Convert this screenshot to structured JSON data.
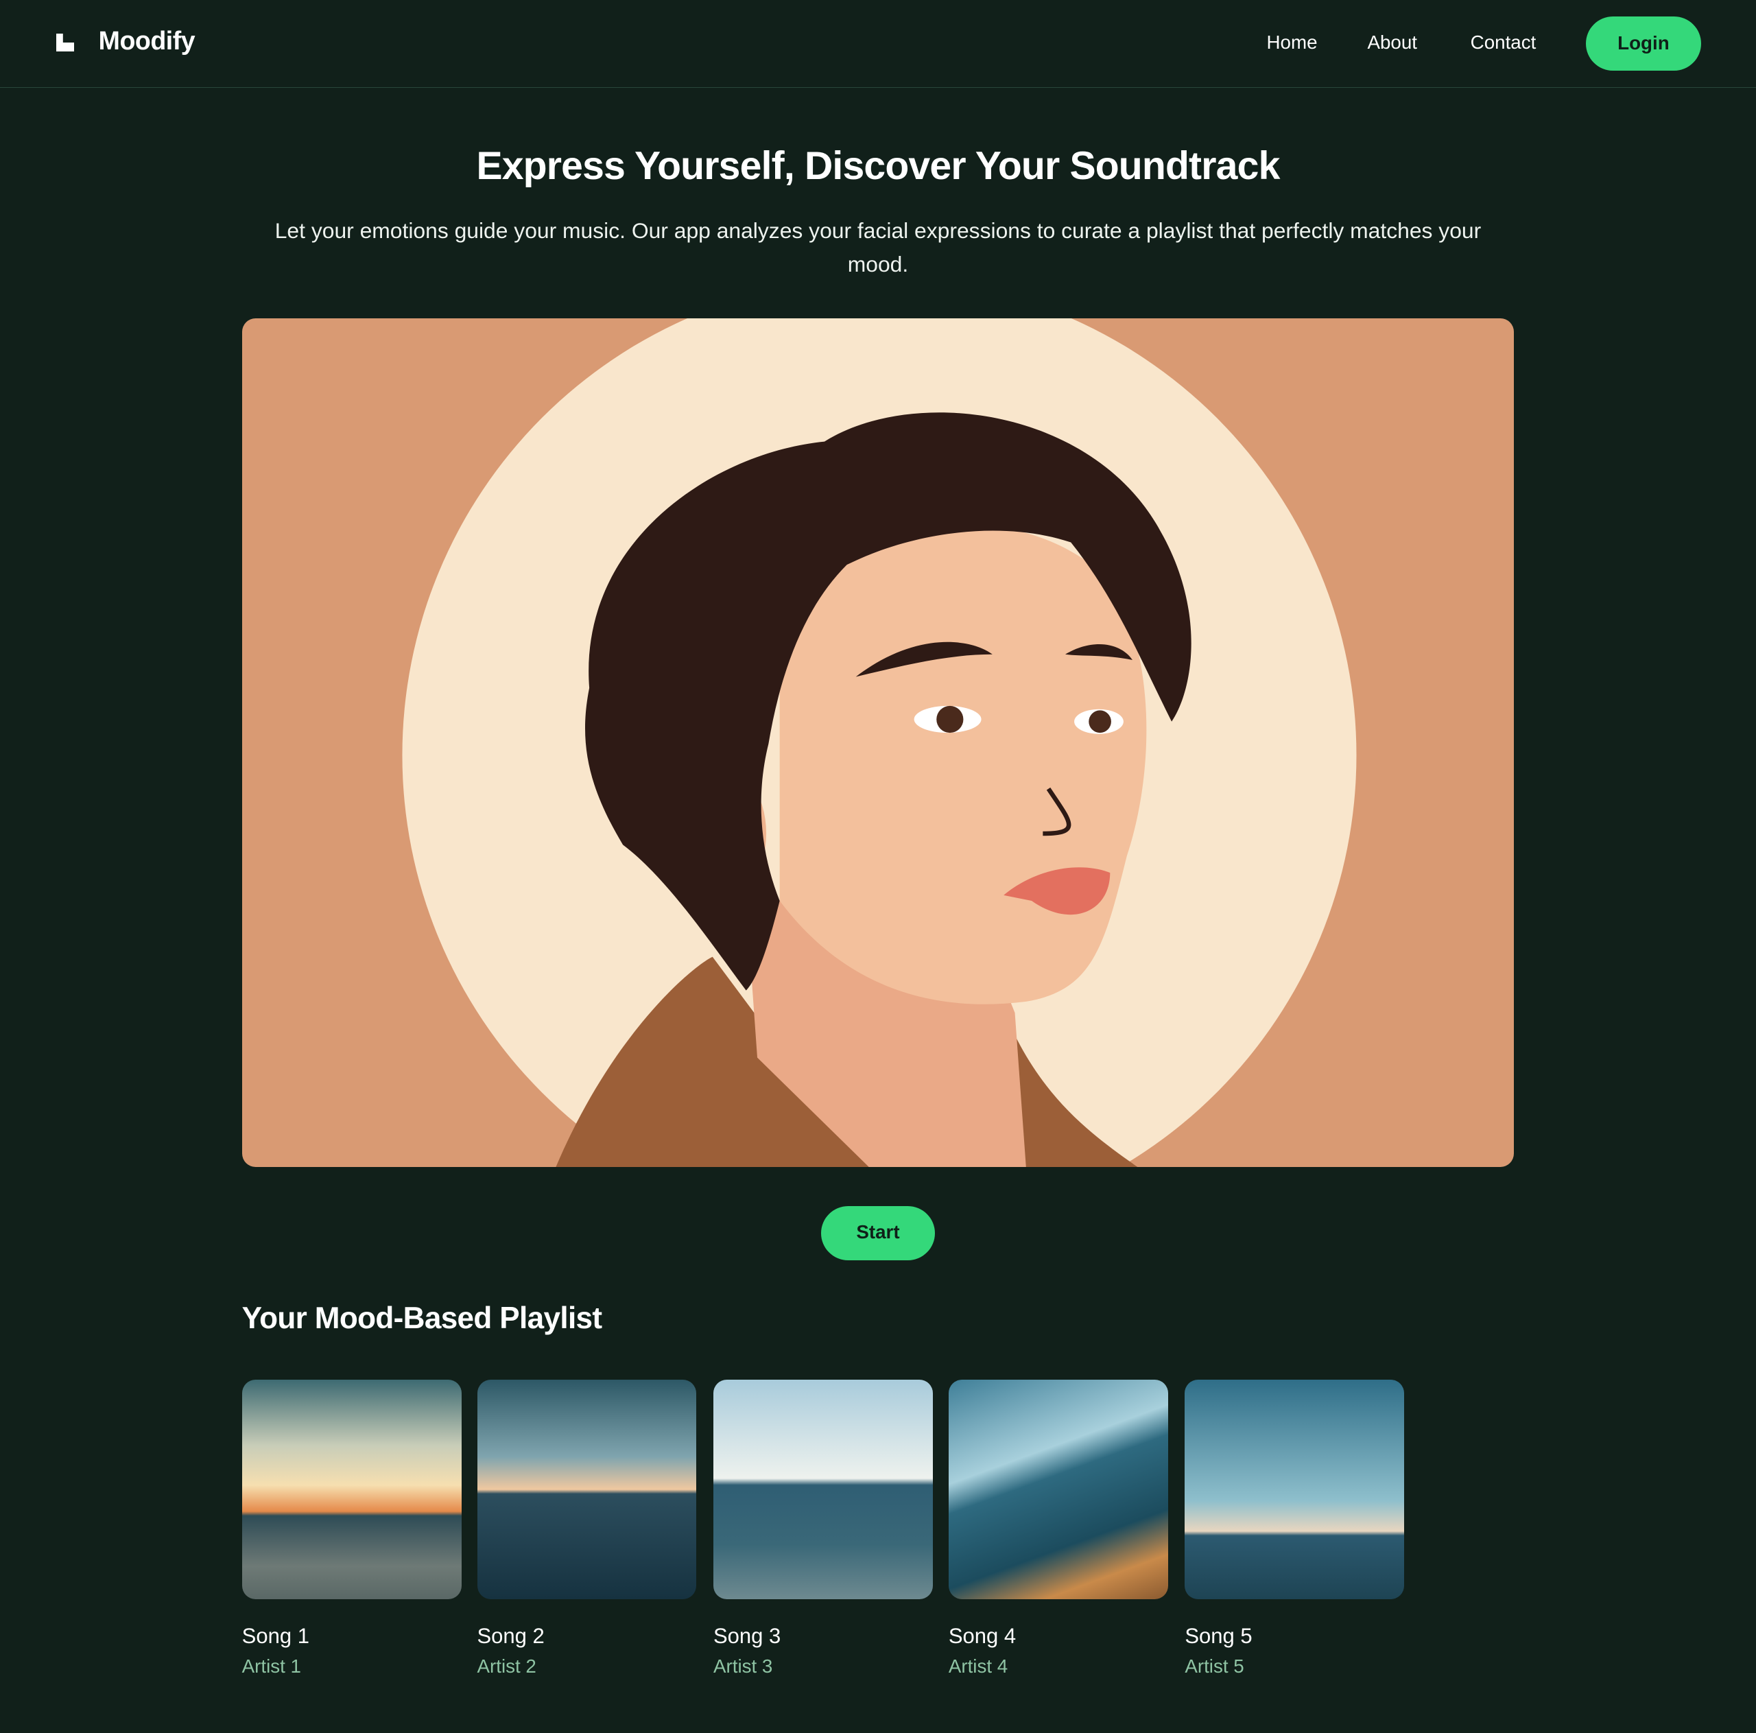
{
  "header": {
    "brand": "Moodify",
    "logo_icon": "stair-step-logo-icon",
    "nav": [
      "Home",
      "About",
      "Contact"
    ],
    "login_label": "Login"
  },
  "hero": {
    "title": "Express Yourself, Discover Your Soundtrack",
    "subtitle": "Let your emotions guide your music. Our app analyzes your facial expressions to curate a playlist that perfectly matches your mood.",
    "start_label": "Start"
  },
  "playlist": {
    "heading": "Your Mood-Based Playlist",
    "items": [
      {
        "song": "Song 1",
        "artist": "Artist 1"
      },
      {
        "song": "Song 2",
        "artist": "Artist 2"
      },
      {
        "song": "Song 3",
        "artist": "Artist 3"
      },
      {
        "song": "Song 4",
        "artist": "Artist 4"
      },
      {
        "song": "Song 5",
        "artist": "Artist 5"
      }
    ]
  },
  "colors": {
    "background": "#11201a",
    "accent": "#34d87a",
    "artist_text": "#8fc4a4"
  }
}
